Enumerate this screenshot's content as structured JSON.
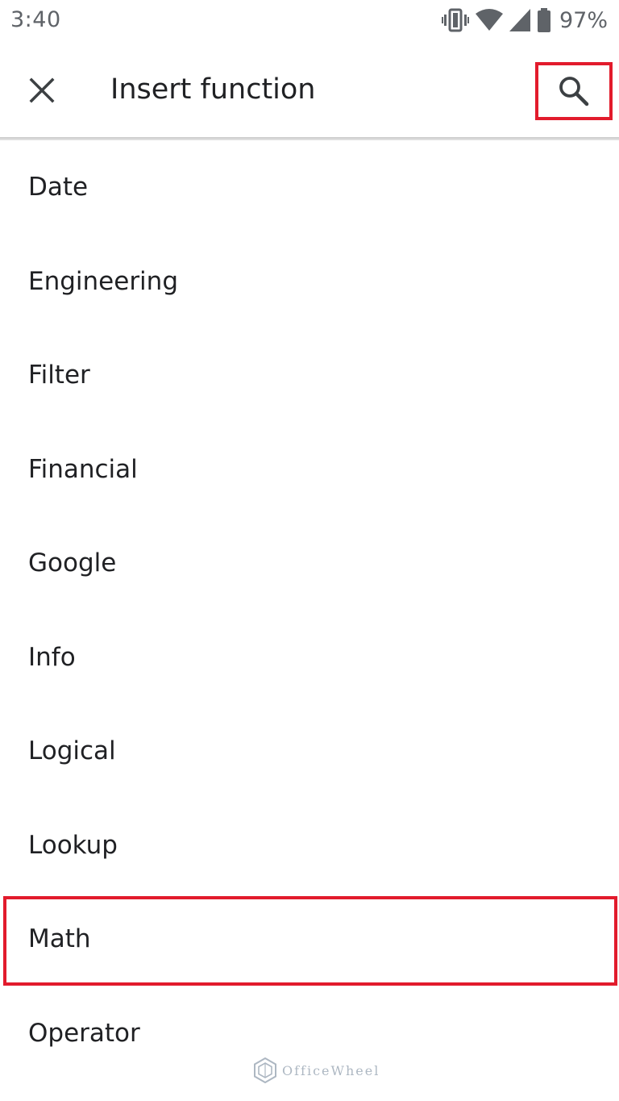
{
  "status_bar": {
    "time": "3:40",
    "battery_percent": "97%",
    "icons": [
      "vibrate-icon",
      "wifi-icon",
      "signal-icon",
      "battery-icon"
    ]
  },
  "app_bar": {
    "title": "Insert function",
    "close_icon": "close-icon",
    "search_icon": "search-icon"
  },
  "categories": [
    {
      "label": "Date"
    },
    {
      "label": "Engineering"
    },
    {
      "label": "Filter"
    },
    {
      "label": "Financial"
    },
    {
      "label": "Google"
    },
    {
      "label": "Info"
    },
    {
      "label": "Logical"
    },
    {
      "label": "Lookup"
    },
    {
      "label": "Math"
    },
    {
      "label": "Operator"
    }
  ],
  "highlighted_category": "Math",
  "watermark": {
    "text": "OfficeWheel"
  },
  "colors": {
    "highlight": "#e21b2c",
    "text": "#202124",
    "status_text": "#5f6368"
  }
}
